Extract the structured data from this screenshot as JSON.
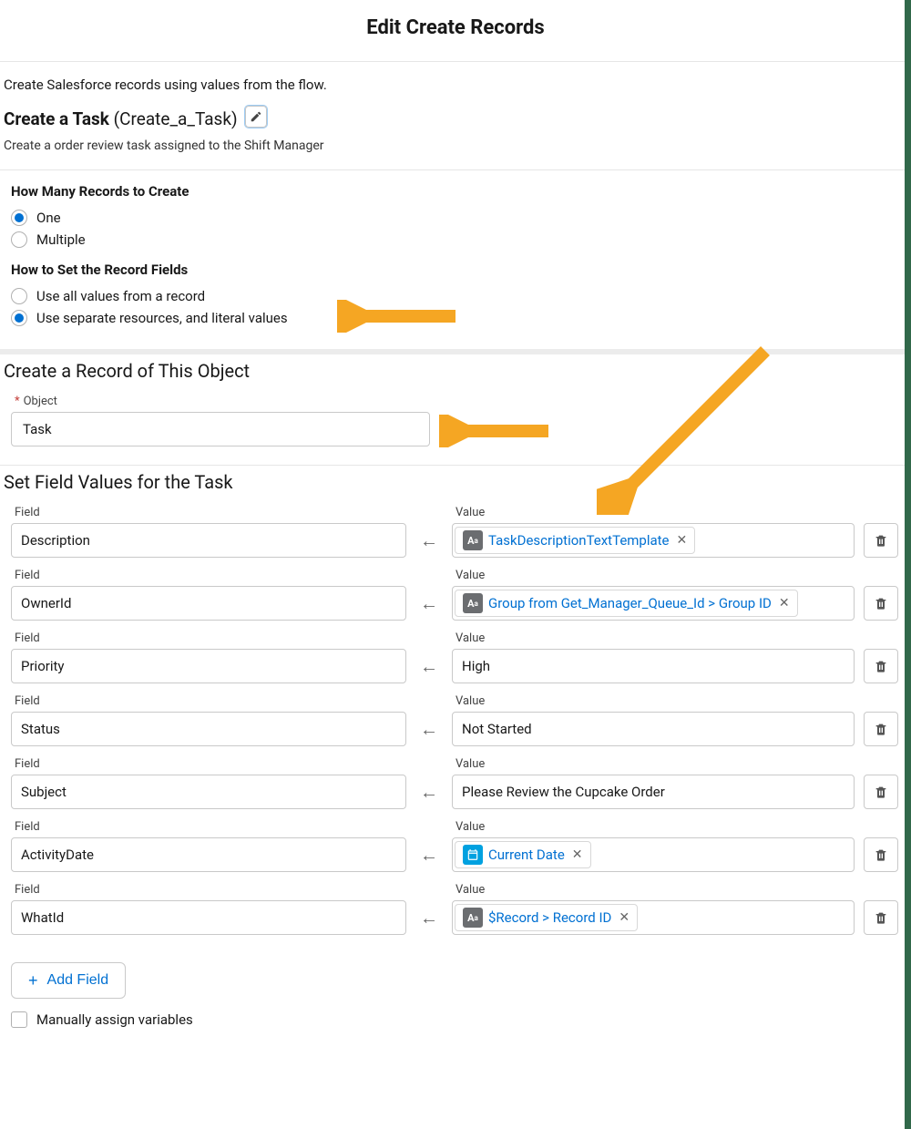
{
  "title": "Edit Create Records",
  "intro": "Create Salesforce records using values from the flow.",
  "element": {
    "label": "Create a Task",
    "api_name": "(Create_a_Task)",
    "description": "Create a order review task assigned to the Shift Manager"
  },
  "how_many": {
    "heading": "How Many Records to Create",
    "options": [
      {
        "label": "One",
        "selected": true
      },
      {
        "label": "Multiple",
        "selected": false
      }
    ]
  },
  "how_set": {
    "heading": "How to Set the Record Fields",
    "options": [
      {
        "label": "Use all values from a record",
        "selected": false
      },
      {
        "label": "Use separate resources, and literal values",
        "selected": true
      }
    ]
  },
  "object_section": {
    "heading": "Create a Record of This Object",
    "label": "Object",
    "value": "Task"
  },
  "fields_section": {
    "heading": "Set Field Values for the Task",
    "field_label": "Field",
    "value_label": "Value",
    "rows": [
      {
        "field": "Description",
        "value_type": "text-template",
        "value": "TaskDescriptionTextTemplate"
      },
      {
        "field": "OwnerId",
        "value_type": "text-template",
        "value": "Group from Get_Manager_Queue_Id > Group ID"
      },
      {
        "field": "Priority",
        "value_type": "literal",
        "value": "High"
      },
      {
        "field": "Status",
        "value_type": "literal",
        "value": "Not Started"
      },
      {
        "field": "Subject",
        "value_type": "literal",
        "value": "Please Review the Cupcake Order"
      },
      {
        "field": "ActivityDate",
        "value_type": "date",
        "value": "Current Date"
      },
      {
        "field": "WhatId",
        "value_type": "text-template",
        "value": "$Record > Record ID"
      }
    ]
  },
  "add_field_label": "Add Field",
  "manual_assign_label": "Manually assign variables",
  "colors": {
    "arrow": "#f5a623"
  }
}
